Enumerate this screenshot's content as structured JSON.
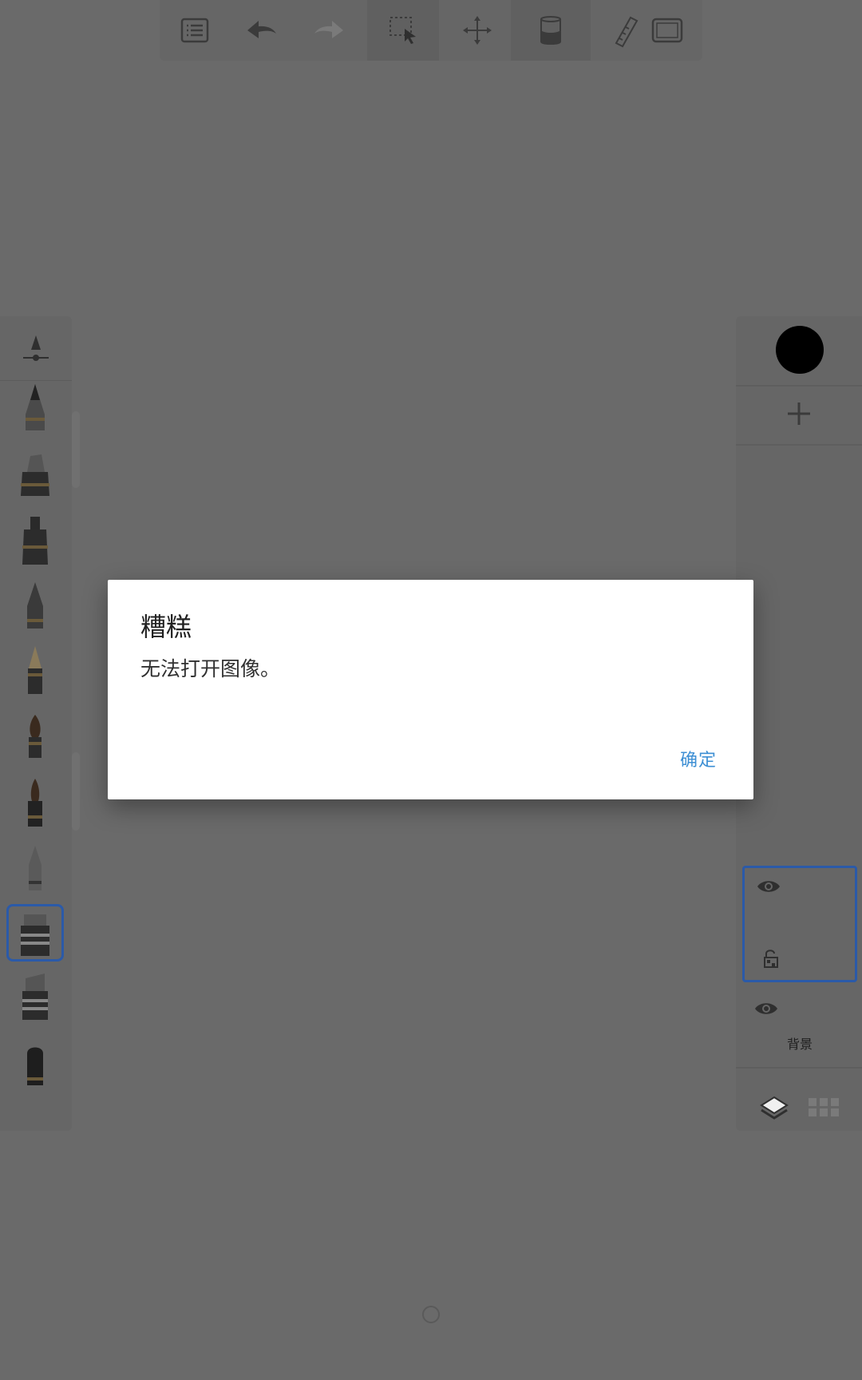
{
  "toolbar": {
    "icons": [
      "list-icon",
      "undo-icon",
      "redo-icon",
      "selection-icon",
      "move-icon",
      "paint-bucket-icon",
      "ruler-icon",
      "fullscreen-icon"
    ]
  },
  "brush_panel": {
    "settings_icon": "brush-settings-icon",
    "brushes": [
      "pencil",
      "ink-pen",
      "marker",
      "airbrush",
      "fountain-pen",
      "paint-brush",
      "ink-brush",
      "soft-eraser",
      "chisel-marker",
      "wide-marker",
      "blender"
    ],
    "selected_index": 8
  },
  "right_panel": {
    "current_color": "#000000",
    "layers": [
      {
        "name": "",
        "visible": true,
        "selected": true
      },
      {
        "name": "背景",
        "visible": true,
        "selected": false
      }
    ]
  },
  "dialog": {
    "title": "糟糕",
    "message": "无法打开图像。",
    "ok_label": "确定",
    "ok_color": "#3d8fd4"
  }
}
